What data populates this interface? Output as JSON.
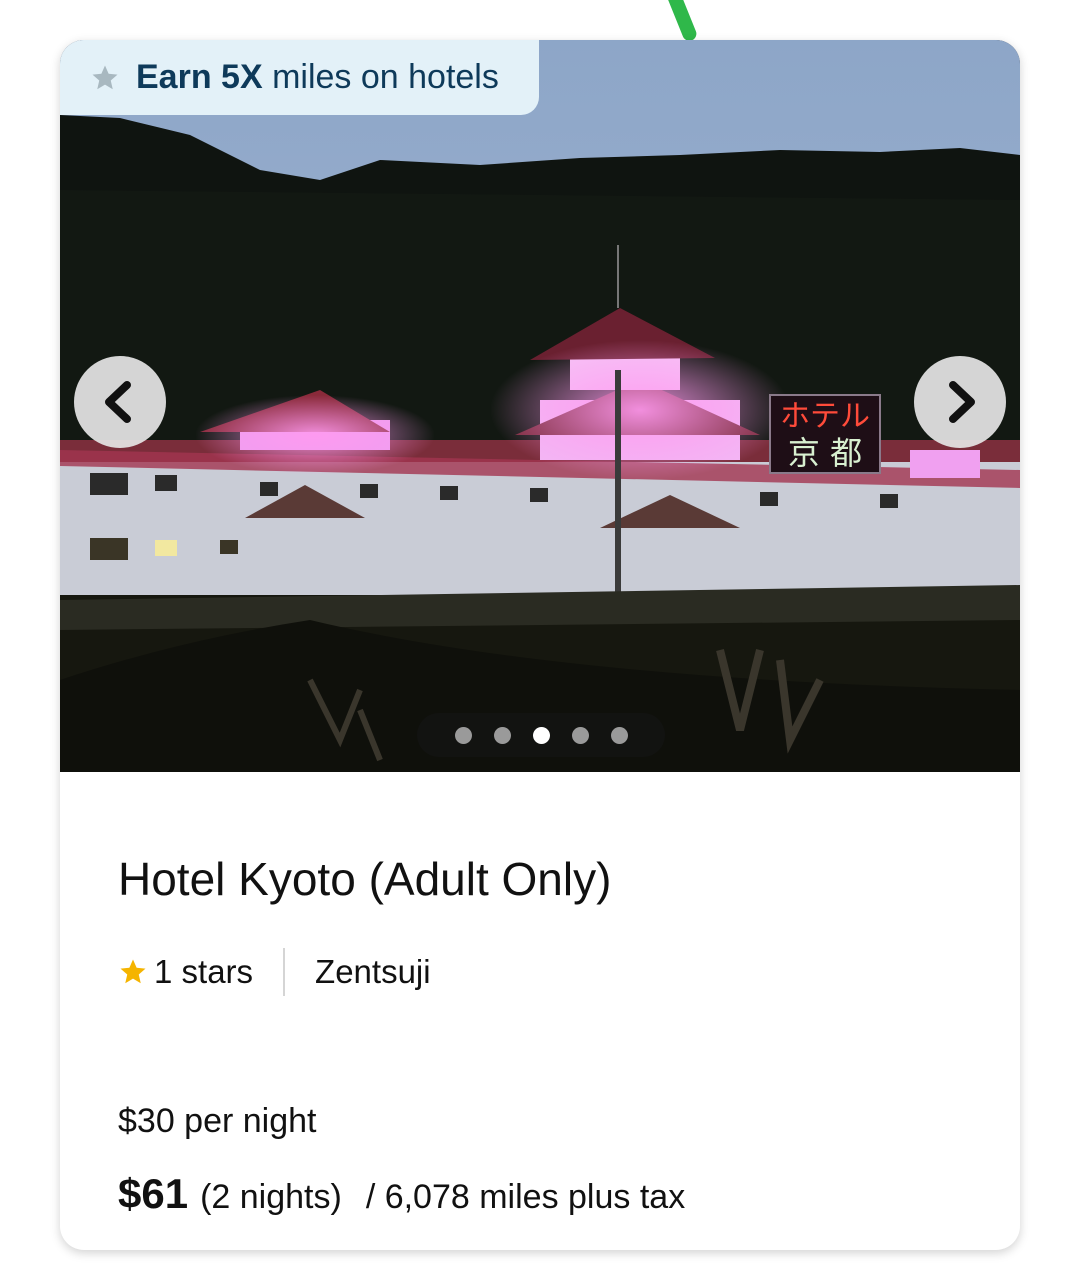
{
  "promo": {
    "bold": "Earn 5X",
    "rest": " miles on hotels",
    "icon": "star-icon",
    "icon_color": "#a8b8c0"
  },
  "carousel": {
    "prev_icon": "chevron-left-icon",
    "next_icon": "chevron-right-icon",
    "slide_count": 5,
    "active_index": 2,
    "photo_description_sign": "ホテル京都"
  },
  "hotel": {
    "name": "Hotel Kyoto (Adult Only)",
    "rating_label": "1 stars",
    "rating_icon": "star-icon",
    "rating_color": "#f5b400",
    "location": "Zentsuji"
  },
  "pricing": {
    "per_night": "$30  per night",
    "total_price": "$61",
    "total_nights": "(2 nights)",
    "miles": "/  6,078 miles plus tax"
  },
  "colors": {
    "promo_bg": "#e3f1f8",
    "promo_text": "#0e3a5a"
  }
}
